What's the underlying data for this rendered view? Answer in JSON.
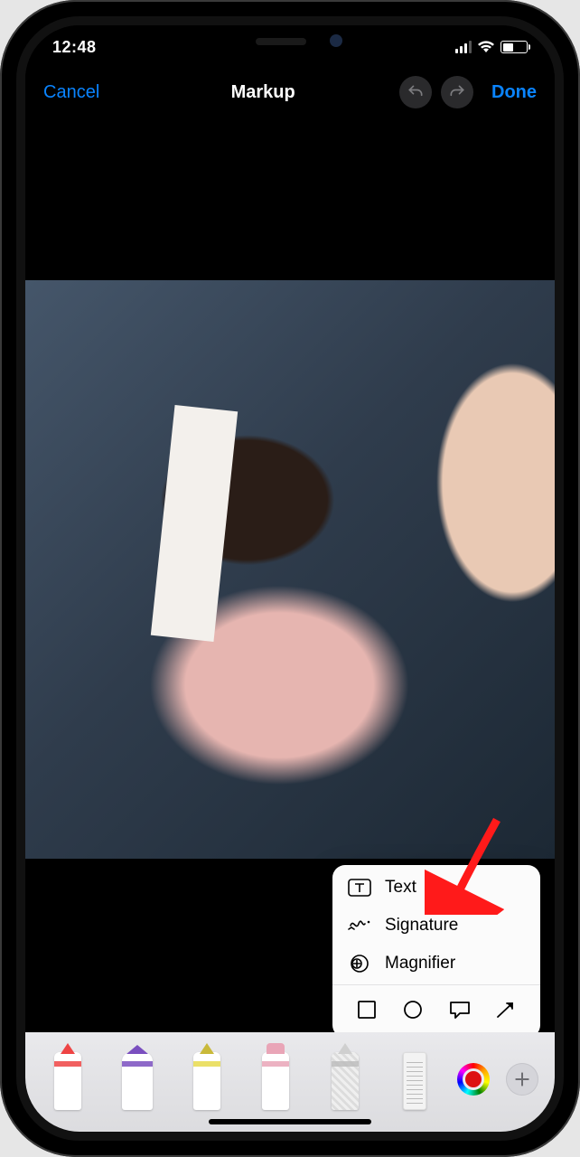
{
  "status": {
    "time": "12:48"
  },
  "nav": {
    "cancel": "Cancel",
    "title": "Markup",
    "done": "Done"
  },
  "popup": {
    "items": [
      {
        "icon": "text-icon",
        "label": "Text"
      },
      {
        "icon": "signature-icon",
        "label": "Signature"
      },
      {
        "icon": "magnifier-icon",
        "label": "Magnifier"
      }
    ],
    "shapes": [
      "square",
      "circle",
      "speech-bubble",
      "arrow"
    ]
  },
  "tools": [
    "pen",
    "marker",
    "pencil",
    "eraser",
    "lasso",
    "ruler"
  ],
  "colors": {
    "selected": "#d11a1a",
    "accent": "#0a84ff"
  }
}
